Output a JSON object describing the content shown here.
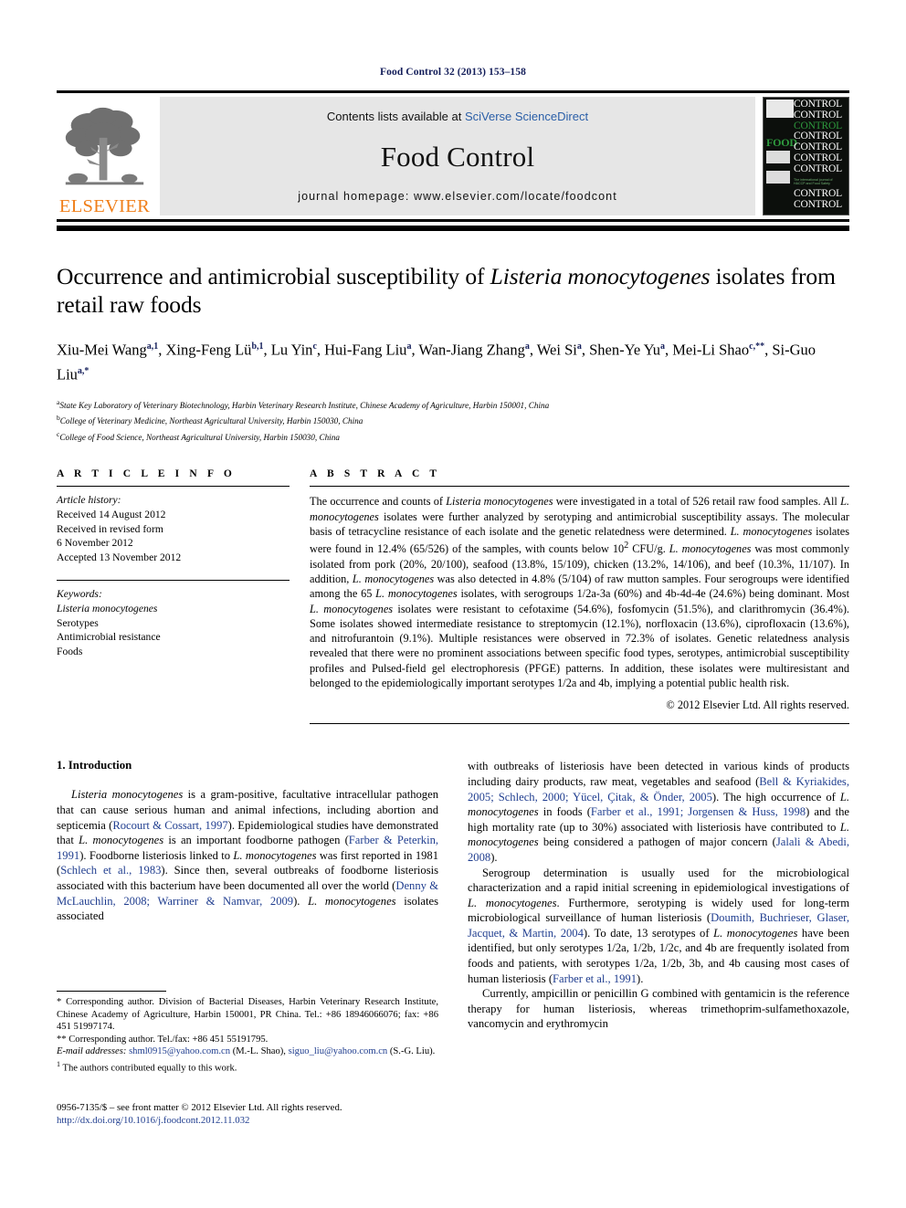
{
  "running_head": "Food Control 32 (2013) 153–158",
  "banner": {
    "publisher": "ELSEVIER",
    "contents_prefix": "Contents lists available at ",
    "contents_link": "SciVerse ScienceDirect",
    "journal_name": "Food Control",
    "homepage": "journal homepage: www.elsevier.com/locate/foodcont",
    "cover": {
      "food_word": "FOOD",
      "control_word": "CONTROL",
      "tagline": "The international journal of HACCP and Food Safety"
    }
  },
  "article": {
    "title_part1": "Occurrence and antimicrobial susceptibility of ",
    "title_italic": "Listeria monocytogenes",
    "title_part2": " isolates from retail raw foods",
    "authors": "Xiu-Mei Wang a,1, Xing-Feng Lü b,1, Lu Yin c, Hui-Fang Liu a, Wan-Jiang Zhang a, Wei Si a, Shen-Ye Yu a, Mei-Li Shao c,**, Si-Guo Liu a,*",
    "affiliations": [
      "State Key Laboratory of Veterinary Biotechnology, Harbin Veterinary Research Institute, Chinese Academy of Agriculture, Harbin 150001, China",
      "College of Veterinary Medicine, Northeast Agricultural University, Harbin 150030, China",
      "College of Food Science, Northeast Agricultural University, Harbin 150030, China"
    ],
    "affiliation_marks": [
      "a",
      "b",
      "c"
    ]
  },
  "article_info": {
    "heading": "A R T I C L E   I N F O",
    "history_label": "Article history:",
    "history": [
      "Received 14 August 2012",
      "Received in revised form",
      "6 November 2012",
      "Accepted 13 November 2012"
    ],
    "keywords_label": "Keywords:",
    "keywords": [
      "Listeria monocytogenes",
      "Serotypes",
      "Antimicrobial resistance",
      "Foods"
    ]
  },
  "abstract": {
    "heading": "A B S T R A C T",
    "text": "The occurrence and counts of Listeria monocytogenes were investigated in a total of 526 retail raw food samples. All L. monocytogenes isolates were further analyzed by serotyping and antimicrobial susceptibility assays. The molecular basis of tetracycline resistance of each isolate and the genetic relatedness were determined. L. monocytogenes isolates were found in 12.4% (65/526) of the samples, with counts below 10² CFU/g. L. monocytogenes was most commonly isolated from pork (20%, 20/100), seafood (13.8%, 15/109), chicken (13.2%, 14/106), and beef (10.3%, 11/107). In addition, L. monocytogenes was also detected in 4.8% (5/104) of raw mutton samples. Four serogroups were identified among the 65 L. monocytogenes isolates, with serogroups 1/2a-3a (60%) and 4b-4d-4e (24.6%) being dominant. Most L. monocytogenes isolates were resistant to cefotaxime (54.6%), fosfomycin (51.5%), and clarithromycin (36.4%). Some isolates showed intermediate resistance to streptomycin (12.1%), norfloxacin (13.6%), ciprofloxacin (13.6%), and nitrofurantoin (9.1%). Multiple resistances were observed in 72.3% of isolates. Genetic relatedness analysis revealed that there were no prominent associations between specific food types, serotypes, antimicrobial susceptibility profiles and Pulsed-field gel electrophoresis (PFGE) patterns. In addition, these isolates were multiresistant and belonged to the epidemiologically important serotypes 1/2a and 4b, implying a potential public health risk.",
    "copyright": "© 2012 Elsevier Ltd. All rights reserved."
  },
  "introduction": {
    "heading": "1. Introduction",
    "left_paragraph": "Listeria monocytogenes is a gram-positive, facultative intracellular pathogen that can cause serious human and animal infections, including abortion and septicemia (Rocourt & Cossart, 1997). Epidemiological studies have demonstrated that L. monocytogenes is an important foodborne pathogen (Farber & Peterkin, 1991). Foodborne listeriosis linked to L. monocytogenes was first reported in 1981 (Schlech et al., 1983). Since then, several outbreaks of foodborne listeriosis associated with this bacterium have been documented all over the world (Denny & McLauchlin, 2008; Warriner & Namvar, 2009). L. monocytogenes isolates associated",
    "right_paragraph_1": "with outbreaks of listeriosis have been detected in various kinds of products including dairy products, raw meat, vegetables and seafood (Bell & Kyriakides, 2005; Schlech, 2000; Yücel, Çitak, & Önder, 2005). The high occurrence of L. monocytogenes in foods (Farber et al., 1991; Jorgensen & Huss, 1998) and the high mortality rate (up to 30%) associated with listeriosis have contributed to L. monocytogenes being considered a pathogen of major concern (Jalali & Abedi, 2008).",
    "right_paragraph_2": "Serogroup determination is usually used for the microbiological characterization and a rapid initial screening in epidemiological investigations of L. monocytogenes. Furthermore, serotyping is widely used for long-term microbiological surveillance of human listeriosis (Doumith, Buchrieser, Glaser, Jacquet, & Martin, 2004). To date, 13 serotypes of L. monocytogenes have been identified, but only serotypes 1/2a, 1/2b, 1/2c, and 4b are frequently isolated from foods and patients, with serotypes 1/2a, 1/2b, 3b, and 4b causing most cases of human listeriosis (Farber et al., 1991).",
    "right_paragraph_3": "Currently, ampicillin or penicillin G combined with gentamicin is the reference therapy for human listeriosis, whereas trimethoprim-sulfamethoxazole, vancomycin and erythromycin"
  },
  "footnotes": {
    "corresponding_1": "* Corresponding author. Division of Bacterial Diseases, Harbin Veterinary Research Institute, Chinese Academy of Agriculture, Harbin 150001, PR China. Tel.: +86 18946066076; fax: +86 451 51997174.",
    "corresponding_2": "** Corresponding author. Tel./fax: +86 451 55191795.",
    "email_label": "E-mail addresses:",
    "email_1": "shml0915@yahoo.com.cn",
    "email_1_owner": " (M.-L. Shao), ",
    "email_2": "siguo_liu@yahoo.com.cn",
    "email_2_owner": " (S.-G. Liu).",
    "equal_contribution_mark": "1",
    "equal_contribution": "The authors contributed equally to this work."
  },
  "footer": {
    "issn_line": "0956-7135/$ – see front matter © 2012 Elsevier Ltd. All rights reserved.",
    "doi": "http://dx.doi.org/10.1016/j.foodcont.2012.11.032"
  },
  "colors": {
    "running_head": "#141e5a",
    "citation_blue": "#1f3d8f",
    "link_blue": "#2b5fa8",
    "elsevier_orange": "#f07f1a",
    "cover_green": "#2e9b3e"
  }
}
